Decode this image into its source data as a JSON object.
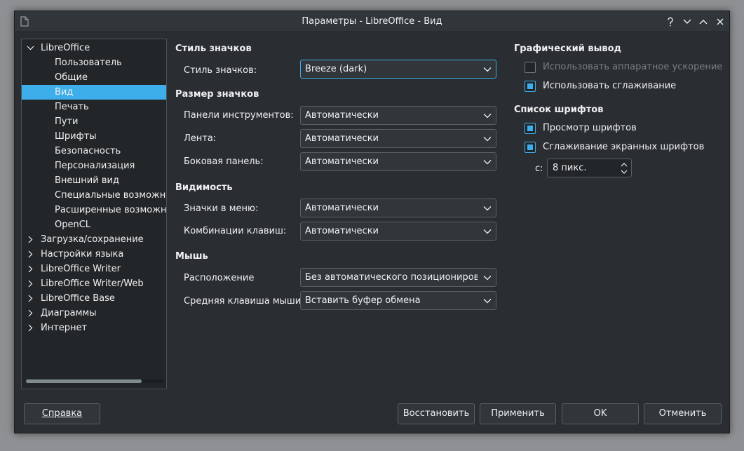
{
  "window": {
    "title": "Параметры - LibreOffice - Вид"
  },
  "nav": {
    "items": [
      {
        "label": "LibreOffice",
        "level": 0,
        "expander": "open"
      },
      {
        "label": "Пользователь",
        "level": 1
      },
      {
        "label": "Общие",
        "level": 1
      },
      {
        "label": "Вид",
        "level": 1,
        "selected": true
      },
      {
        "label": "Печать",
        "level": 1
      },
      {
        "label": "Пути",
        "level": 1
      },
      {
        "label": "Шрифты",
        "level": 1
      },
      {
        "label": "Безопасность",
        "level": 1
      },
      {
        "label": "Персонализация",
        "level": 1
      },
      {
        "label": "Внешний вид",
        "level": 1
      },
      {
        "label": "Специальные возможности",
        "level": 1
      },
      {
        "label": "Расширенные возможности",
        "level": 1
      },
      {
        "label": "OpenCL",
        "level": 1
      },
      {
        "label": "Загрузка/сохранение",
        "level": 0,
        "expander": "closed"
      },
      {
        "label": "Настройки языка",
        "level": 0,
        "expander": "closed"
      },
      {
        "label": "LibreOffice Writer",
        "level": 0,
        "expander": "closed"
      },
      {
        "label": "LibreOffice Writer/Web",
        "level": 0,
        "expander": "closed"
      },
      {
        "label": "LibreOffice Base",
        "level": 0,
        "expander": "closed"
      },
      {
        "label": "Диаграммы",
        "level": 0,
        "expander": "closed"
      },
      {
        "label": "Интернет",
        "level": 0,
        "expander": "closed"
      }
    ]
  },
  "icon_style": {
    "title": "Стиль значков",
    "label": "Стиль значков:",
    "value": "Breeze (dark)"
  },
  "icon_size": {
    "title": "Размер значков",
    "toolbars_label": "Панели инструментов:",
    "toolbars_value": "Автоматически",
    "ribbon_label": "Лента:",
    "ribbon_value": "Автоматически",
    "sidebar_label": "Боковая панель:",
    "sidebar_value": "Автоматически"
  },
  "visibility": {
    "title": "Видимость",
    "menu_icons_label": "Значки в меню:",
    "menu_icons_value": "Автоматически",
    "shortcuts_label": "Комбинации клавиш:",
    "shortcuts_value": "Автоматически"
  },
  "mouse": {
    "title": "Мышь",
    "position_label": "Расположение",
    "position_value": "Без автоматического позиционирования",
    "middle_label": "Средняя клавиша мыши:",
    "middle_value": "Вставить буфер обмена"
  },
  "graphics": {
    "title": "Графический вывод",
    "hw_accel_label": "Использовать аппаратное ускорение",
    "hw_accel_checked": false,
    "antialias_label": "Использовать сглаживание",
    "antialias_checked": true
  },
  "font_list": {
    "title": "Список шрифтов",
    "preview_label": "Просмотр шрифтов",
    "preview_checked": true,
    "screen_aa_label": "Сглаживание экранных шрифтов",
    "screen_aa_checked": true,
    "from_label": "с:",
    "from_value": "8 пикс."
  },
  "buttons": {
    "help": "Справка",
    "reset": "Восстановить",
    "apply": "Применить",
    "ok": "OK",
    "cancel": "Отменить"
  },
  "colors": {
    "accent": "#3daee9",
    "background": "#2a2e32"
  }
}
